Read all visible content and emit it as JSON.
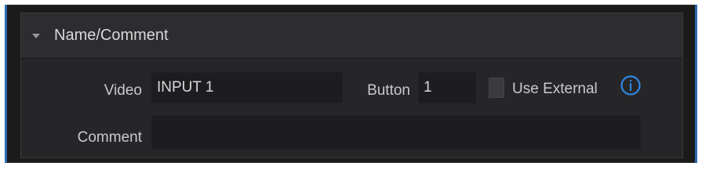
{
  "section": {
    "title": "Name/Comment",
    "expanded": true
  },
  "video": {
    "label": "Video",
    "value": "INPUT 1"
  },
  "button": {
    "label": "Button",
    "value": "1"
  },
  "use_external": {
    "label": "Use External",
    "checked": false
  },
  "comment": {
    "label": "Comment",
    "value": ""
  },
  "icons": {
    "section_toggle": "chevron-down-icon",
    "info": "info-icon"
  },
  "colors": {
    "accent": "#2c6bb3",
    "info_icon": "#2f86e0"
  }
}
